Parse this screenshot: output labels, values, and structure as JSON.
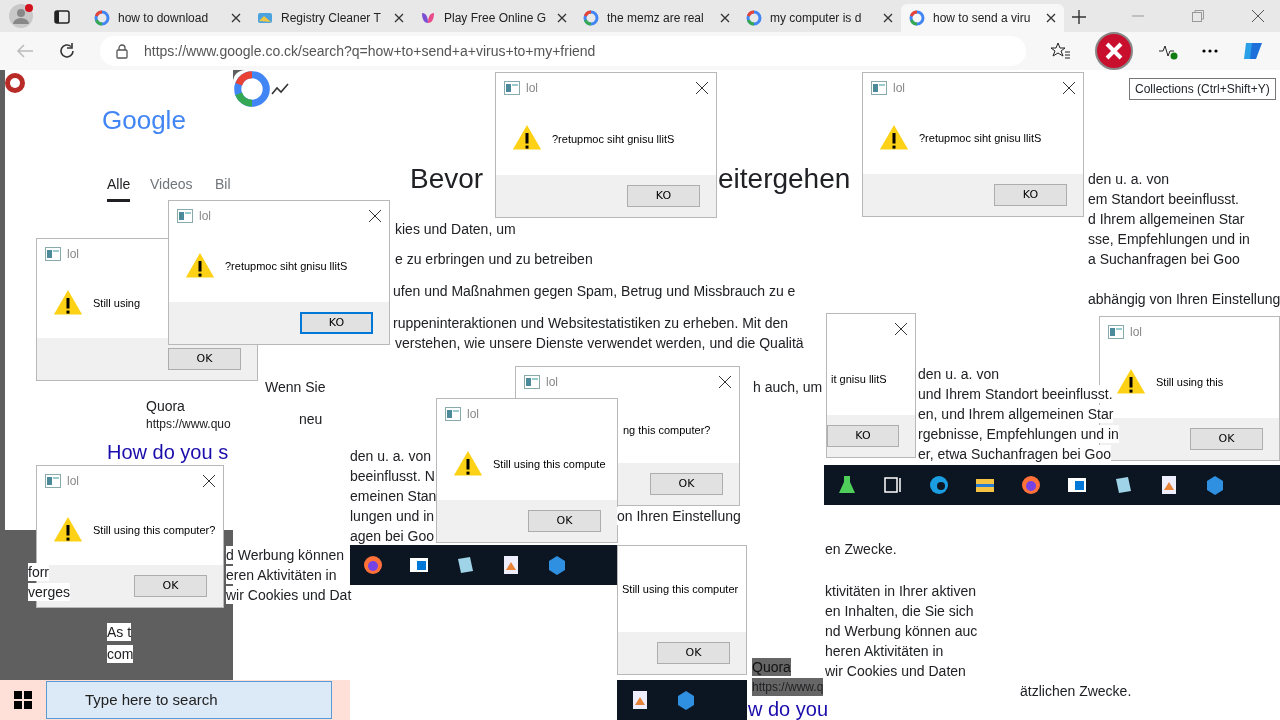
{
  "browser": {
    "tabs": [
      {
        "title": "how to download",
        "selected": false
      },
      {
        "title": "Registry Cleaner T",
        "selected": false
      },
      {
        "title": "Play Free Online G",
        "selected": false
      },
      {
        "title": "the memz are real",
        "selected": false
      },
      {
        "title": "my computer is d",
        "selected": false
      },
      {
        "title": "how to send a viru",
        "selected": true
      }
    ],
    "address": "https://www.google.co.ck/search?q=how+to+send+a+virus+to+my+friend",
    "tooltip": "Collections (Ctrl+Shift+Y)"
  },
  "results_page": {
    "logo": "Google",
    "nav": [
      {
        "label": "Alle",
        "selected": true
      },
      {
        "label": "Videos",
        "selected": false
      },
      {
        "label": "Bil",
        "selected": false
      }
    ],
    "result": {
      "site": "Quora",
      "url": "https://www.quo",
      "title": "How do you s"
    }
  },
  "consent": {
    "heading": [
      "Bevor",
      "eitergehen"
    ],
    "fragments": [
      "kies und Daten, um",
      "e zu erbringen und zu betreiben",
      "ufen und Maßnahmen gegen Spam, Betrug und Missbrauch zu e",
      "ruppeninteraktionen und Websitestatistiken zu erheben. Mit den",
      "verstehen, wie unsere Dienste verwendet werden, und die Qualitä",
      "Wenn Sie",
      "h auch, um",
      "neu",
      "den u. a. von",
      "und Ihrem Standort beeinflusst.",
      "en, und Ihrem allgemeinen Star",
      "rgebnisse, Empfehlungen und in",
      "er, etwa Suchanfragen bei Goo",
      "den u. a. von",
      "em Standort beeinflusst.",
      "d Ihrem allgemeinen Star",
      "sse, Empfehlungen und in",
      "a Suchanfragen bei Goo",
      "abhängig von Ihren Einstellung",
      "den u. a. von",
      "beeinflusst. N",
      "emeinen Stan",
      "lungen und in",
      "agen bei Goo",
      "d Werbung können",
      "eren Aktivitäten in",
      "wir Cookies und Dat",
      "on Ihren Einstellung",
      "en Zwecke.",
      "ktivitäten in Ihrer aktiven",
      "en Inhalten, die Sie sich",
      "nd Werbung können auc",
      "heren Aktivitäten in",
      "wir Cookies und Daten",
      "ätzlichen Zwecke.",
      "forr",
      "verges",
      "As t",
      "com"
    ]
  },
  "dialogs": [
    {
      "title": "lol",
      "message": "Still using",
      "button": "OK",
      "focused": false,
      "close": false
    },
    {
      "title": "lol",
      "message": "?retupmoc siht gnisu llitS",
      "button": "KO",
      "focused": true,
      "close": true
    },
    {
      "title": "lol",
      "message": "?retupmoc siht gnisu llitS",
      "button": "KO",
      "focused": false,
      "close": true
    },
    {
      "title": "lol",
      "message": "?retupmoc siht gnisu llitS",
      "button": "KO",
      "focused": false,
      "close": true
    },
    {
      "title": "lol",
      "message": "Still using this computer?",
      "button": "OK",
      "focused": false,
      "close": true
    },
    {
      "title": "lol",
      "message": "ng this computer?",
      "button": "OK",
      "focused": false,
      "close": true
    },
    {
      "title": "lol",
      "message": "Still using this compute",
      "button": "OK",
      "focused": false,
      "close": false
    },
    {
      "message": "it gnisu llitS",
      "button": "KO",
      "focused": false,
      "close": true
    },
    {
      "title": "lol",
      "message": "Still using this",
      "button": "OK",
      "focused": false,
      "close": false
    },
    {
      "message": "Still using this computer",
      "button": "OK",
      "focused": false,
      "close": false
    }
  ],
  "second_result": {
    "site": "Quora",
    "url": "https://www.q",
    "title": "w do you"
  },
  "taskbar": {
    "search_placeholder": "Type here to search"
  }
}
